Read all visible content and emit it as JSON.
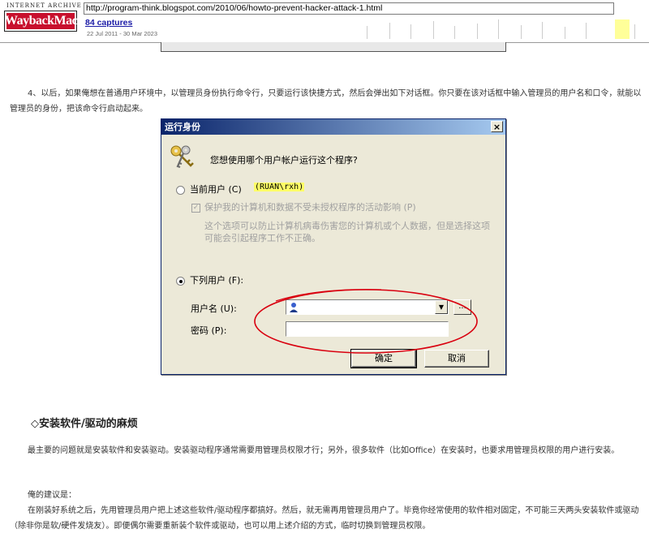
{
  "wayback": {
    "ia_text": "INTERNET ARCHIVE",
    "logo_text": "WaybackMachine",
    "url": "http://program-think.blogspot.com/2010/06/howto-prevent-hacker-attack-1.html",
    "captures": "84 captures",
    "date_range": "22 Jul 2011 - 30 Mar 2023",
    "sparkline_color": "#e8e8e8",
    "highlight_color": "#ffff99"
  },
  "article": {
    "para_4": "4、以后，如果俺想在普通用户环境中，以管理员身份执行命令行，只要运行该快捷方式，然后会弹出如下对话框。你只要在该对话框中输入管理员的用户名和口令，就能以管理员的身份，把该命令行启动起来。",
    "heading": "◇安装软件/驱动的麻烦",
    "para_main": "最主要的问题就是安装软件和安装驱动。安装驱动程序通常需要用管理员权限才行；另外，很多软件（比如Office）在安装时，也要求用管理员权限的用户进行安装。",
    "advice_label": "俺的建议是：",
    "para_advice": "在刚装好系统之后，先用管理员用户把上述这些软件/驱动程序都搞好。然后，就无需再用管理员用户了。毕竟你经常使用的软件相对固定，不可能三天两头安装软件或驱动（除非你是软/硬件发烧友）。即便偶尔需要重新装个软件或驱动，也可以用上述介绍的方式，临时切换到管理员权限。"
  },
  "dialog": {
    "title": "运行身份",
    "close": "×",
    "question": "您想使用哪个用户帐户运行这个程序?",
    "current_user_label": "当前用户 (C)",
    "current_user_value": "(RUAN\\rxh)",
    "protect_label": "保护我的计算机和数据不受未授权程序的活动影响 (P)",
    "protect_desc": "这个选项可以防止计算机病毒伤害您的计算机或个人数据，但是选择这项可能会引起程序工作不正确。",
    "following_user_label": "下列用户 (F):",
    "username_label": "用户名 (U):",
    "password_label": "密码 (P):",
    "browse": "...",
    "ok": "确定",
    "cancel": "取消",
    "title_gradient_start": "#0a246a",
    "title_gradient_end": "#a6caf0",
    "annotation_color": "#d9000f"
  }
}
